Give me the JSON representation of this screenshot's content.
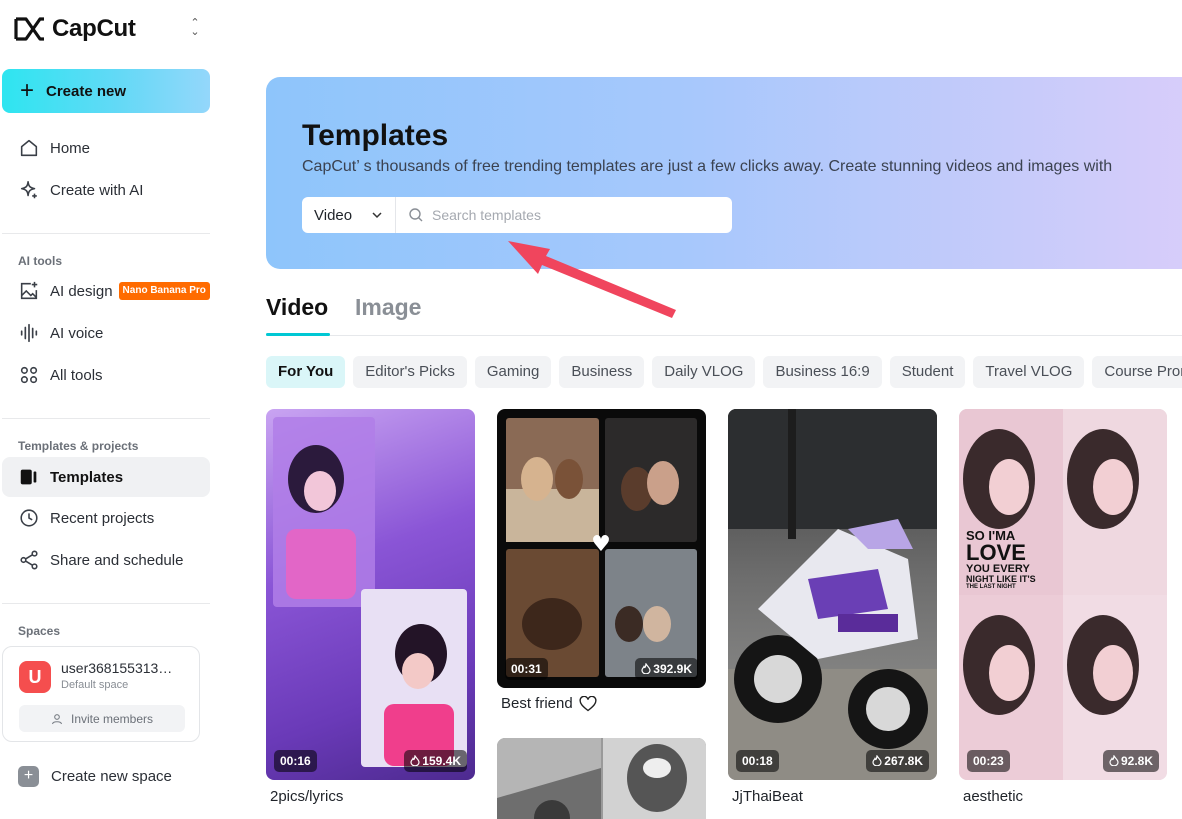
{
  "brand": {
    "name": "CapCut"
  },
  "sidebar": {
    "create_label": "Create new",
    "nav": [
      {
        "label": "Home",
        "icon": "home-icon"
      },
      {
        "label": "Create with AI",
        "icon": "sparkle-icon"
      }
    ],
    "ai_tools": {
      "title": "AI tools",
      "items": [
        {
          "label": "AI design",
          "icon": "image-sparkle-icon",
          "badge": "Nano Banana Pro"
        },
        {
          "label": "AI voice",
          "icon": "waveform-icon"
        },
        {
          "label": "All tools",
          "icon": "grid-icon"
        }
      ]
    },
    "templates_projects": {
      "title": "Templates & projects",
      "items": [
        {
          "label": "Templates",
          "icon": "template-icon",
          "active": true
        },
        {
          "label": "Recent projects",
          "icon": "clock-icon"
        },
        {
          "label": "Share and schedule",
          "icon": "share-icon"
        }
      ]
    },
    "spaces": {
      "title": "Spaces",
      "avatar_letter": "U",
      "user_name": "user368155313…",
      "space_type": "Default space",
      "invite_label": "Invite members",
      "create_space_label": "Create new space"
    }
  },
  "hero": {
    "title": "Templates",
    "subtitle": "CapCut’ s thousands of free trending templates are just a few clicks away. Create stunning videos and images with",
    "type_selected": "Video",
    "search_placeholder": "Search templates"
  },
  "tabs": [
    {
      "label": "Video",
      "active": true
    },
    {
      "label": "Image",
      "active": false
    }
  ],
  "chips": [
    "For You",
    "Editor's Picks",
    "Gaming",
    "Business",
    "Daily VLOG",
    "Business 16:9",
    "Student",
    "Travel VLOG",
    "Course Promo"
  ],
  "cards": [
    {
      "title": "2pics/lyrics",
      "duration": "00:16",
      "uses": "159.4K"
    },
    {
      "title": "Best friend",
      "duration": "00:31",
      "uses": "392.9K"
    },
    {
      "title": "JjThaiBeat",
      "duration": "00:18",
      "uses": "267.8K"
    },
    {
      "title": "aesthetic",
      "duration": "00:23",
      "uses": "92.8K"
    }
  ],
  "overlay": {
    "aesthetic_text": [
      "SO I'MA",
      "LOVE",
      "YOU EVERY",
      "NIGHT LIKE IT'S",
      "THE LAST NIGHT"
    ]
  },
  "colors": {
    "accent": "#00c8d4",
    "badge": "#ff6b00",
    "avatar": "#f54e4e",
    "arrow": "#f0455d"
  }
}
